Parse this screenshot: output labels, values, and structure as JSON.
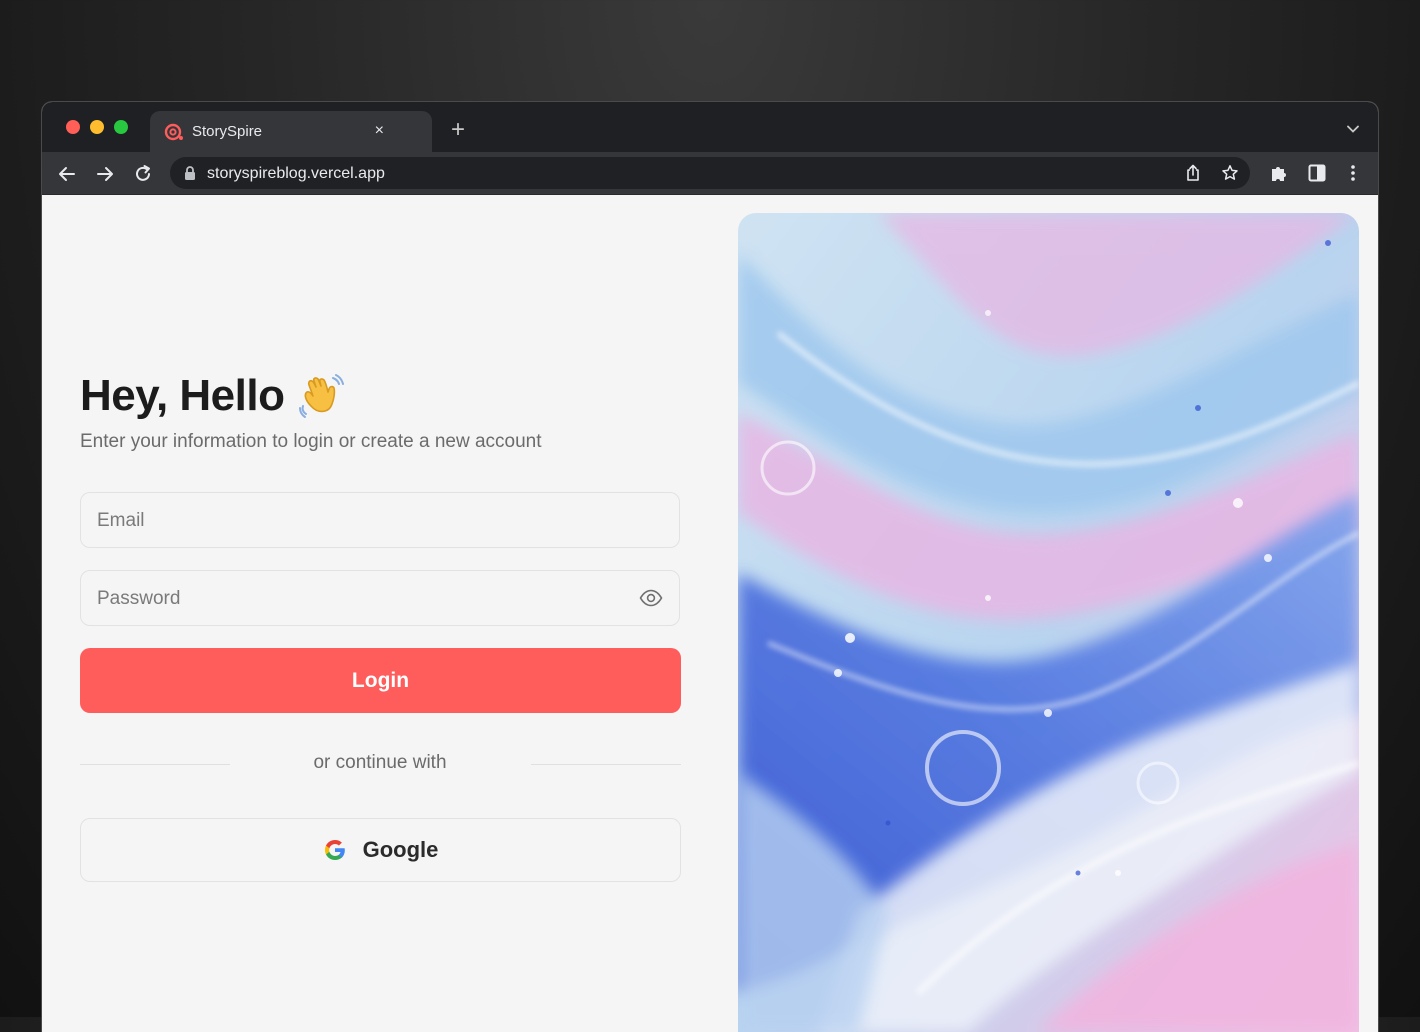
{
  "browser": {
    "tab_title": "StorySpire",
    "tab_close": "×",
    "new_tab": "+",
    "url": "storyspireblog.vercel.app"
  },
  "login": {
    "heading": "Hey, Hello",
    "subtitle": "Enter your information to login or create a new account",
    "email_placeholder": "Email",
    "password_placeholder": "Password",
    "login_label": "Login",
    "divider_text": "or continue with",
    "google_label": "Google"
  },
  "colors": {
    "accent": "#ff5c5c",
    "background": "#f5f5f5"
  },
  "icons": {
    "tab": "storyspire-favicon",
    "wave": "waving-hand-emoji",
    "password_toggle": "eye-icon",
    "google": "google-logo"
  }
}
